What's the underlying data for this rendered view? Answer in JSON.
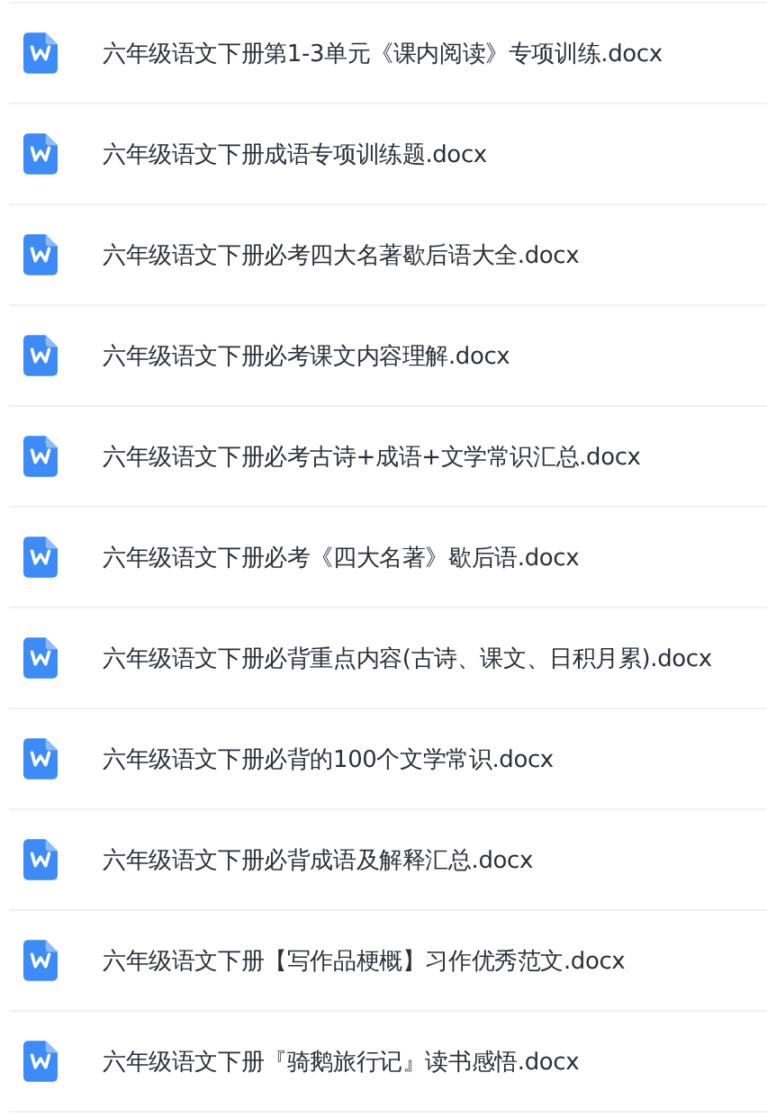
{
  "files": [
    {
      "name": "六年级语文下册第1-3单元《课内阅读》专项训练.docx",
      "kind": "word"
    },
    {
      "name": "六年级语文下册成语专项训练题.docx",
      "kind": "word"
    },
    {
      "name": "六年级语文下册必考四大名著歇后语大全.docx",
      "kind": "word"
    },
    {
      "name": "六年级语文下册必考课文内容理解.docx",
      "kind": "word"
    },
    {
      "name": "六年级语文下册必考古诗+成语+文学常识汇总.docx",
      "kind": "word"
    },
    {
      "name": "六年级语文下册必考《四大名著》歇后语.docx",
      "kind": "word"
    },
    {
      "name": "六年级语文下册必背重点内容(古诗、课文、日积月累).docx",
      "kind": "word"
    },
    {
      "name": "六年级语文下册必背的100个文学常识.docx",
      "kind": "word"
    },
    {
      "name": "六年级语文下册必背成语及解释汇总.docx",
      "kind": "word"
    },
    {
      "name": "六年级语文下册【写作品梗概】习作优秀范文.docx",
      "kind": "word"
    },
    {
      "name": "六年级语文下册『骑鹅旅行记』读书感悟.docx",
      "kind": "word"
    }
  ]
}
